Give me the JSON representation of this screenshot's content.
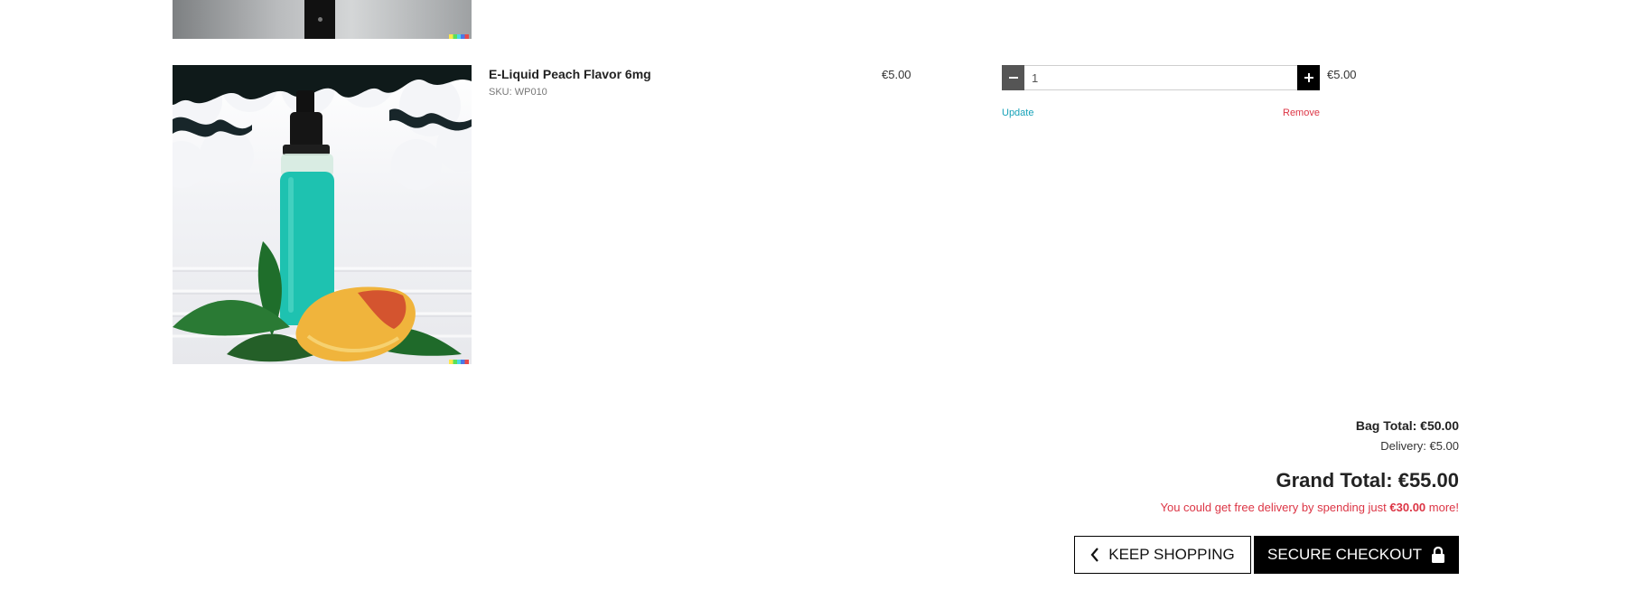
{
  "bag": {
    "items": [
      {
        "name": "E-Liquid Peach Flavor 6mg",
        "sku": "SKU: WP010",
        "price": "€5.00",
        "quantity": "1",
        "subtotal": "€5.00",
        "update_label": "Update",
        "remove_label": "Remove",
        "image_desc_icon": "peach-eliquid-bottle-image"
      }
    ]
  },
  "totals": {
    "bag_total": "Bag Total: €50.00",
    "delivery": "Delivery: €5.00",
    "grand_total": "Grand Total: €55.00",
    "free_delivery_prefix": "You could get free delivery by spending just ",
    "free_delivery_amount": "€30.00",
    "free_delivery_suffix": " more!"
  },
  "actions": {
    "keep_shopping": "KEEP SHOPPING",
    "secure_checkout": "SECURE CHECKOUT"
  },
  "icons": {
    "keep_shopping": "chevron-left-icon",
    "checkout": "lock-icon",
    "minus": "minus-icon",
    "plus": "plus-icon"
  },
  "colors": {
    "update_link": "#17a2b8",
    "remove_link": "#dc3545",
    "free_delivery_text": "#dc3545",
    "checkout_bg": "#000000"
  }
}
